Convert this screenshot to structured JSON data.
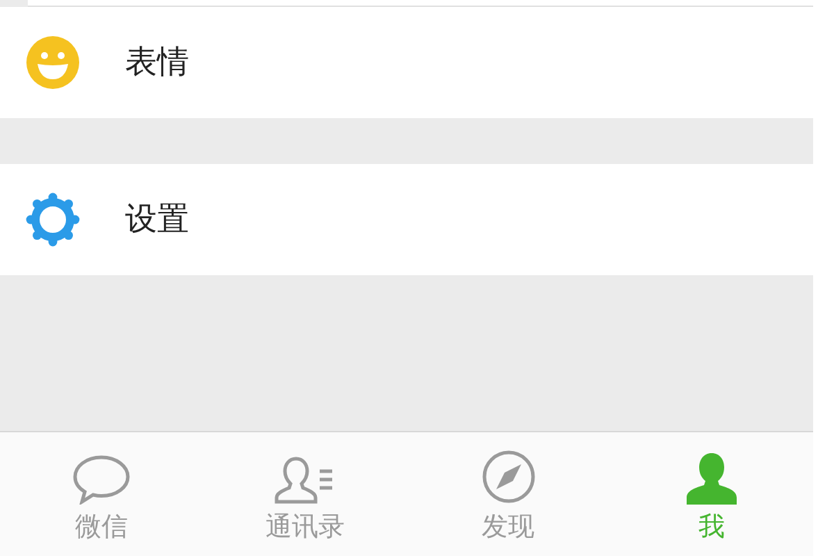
{
  "menu_groups": [
    {
      "items": [
        {
          "kind": "emoji",
          "label": "表情"
        }
      ]
    },
    {
      "items": [
        {
          "kind": "settings",
          "label": "设置"
        }
      ]
    }
  ],
  "tab_bar": [
    {
      "kind": "chat",
      "label": "微信",
      "selected": false
    },
    {
      "kind": "contacts",
      "label": "通讯录",
      "selected": false
    },
    {
      "kind": "discover",
      "label": "发现",
      "selected": false
    },
    {
      "kind": "me",
      "label": "我",
      "selected": true
    }
  ]
}
